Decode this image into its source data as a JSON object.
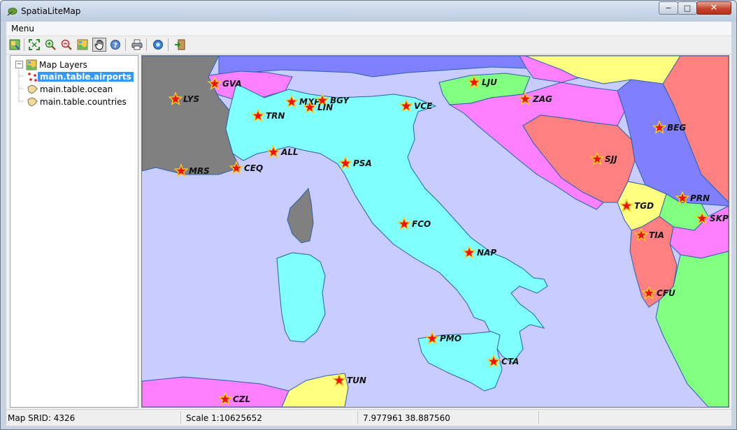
{
  "window": {
    "title": "SpatiaLiteMap",
    "min_glyph": "−",
    "max_glyph": "□",
    "close_glyph": "✕"
  },
  "menubar": {
    "menu_label": "Menu"
  },
  "toolbar": {
    "buttons": [
      {
        "name": "layers-icon"
      },
      {
        "name": "zoom-to-full-icon"
      },
      {
        "name": "zoom-in-icon"
      },
      {
        "name": "zoom-out-icon"
      },
      {
        "name": "map-extent-icon"
      },
      {
        "name": "pan-hand-icon",
        "selected": true
      },
      {
        "name": "identify-icon"
      },
      {
        "name": "print-icon"
      },
      {
        "name": "about-icon"
      },
      {
        "name": "exit-icon"
      }
    ]
  },
  "tree": {
    "root_label": "Map Layers",
    "layers": [
      {
        "label": "main.table.airports",
        "selected": true
      },
      {
        "label": "main.table.ocean"
      },
      {
        "label": "main.table.countries"
      }
    ]
  },
  "map": {
    "ocean_color": "#c8ccff",
    "airports": [
      "GVA",
      "LYS",
      "MXP",
      "BGY",
      "LIN",
      "TRN",
      "VCE",
      "LJU",
      "ZAG",
      "BEG",
      "SJJ",
      "ALL",
      "MRS",
      "CEQ",
      "PSA",
      "FCO",
      "NAP",
      "TGD",
      "PRN",
      "SKP",
      "TIA",
      "CFU",
      "PMO",
      "CTA",
      "TUN",
      "CZL"
    ]
  },
  "status": {
    "srid": "Map SRID: 4326",
    "scale": "Scale 1:10625652",
    "coord_x": "7.977961",
    "coord_y": "38.887560"
  }
}
